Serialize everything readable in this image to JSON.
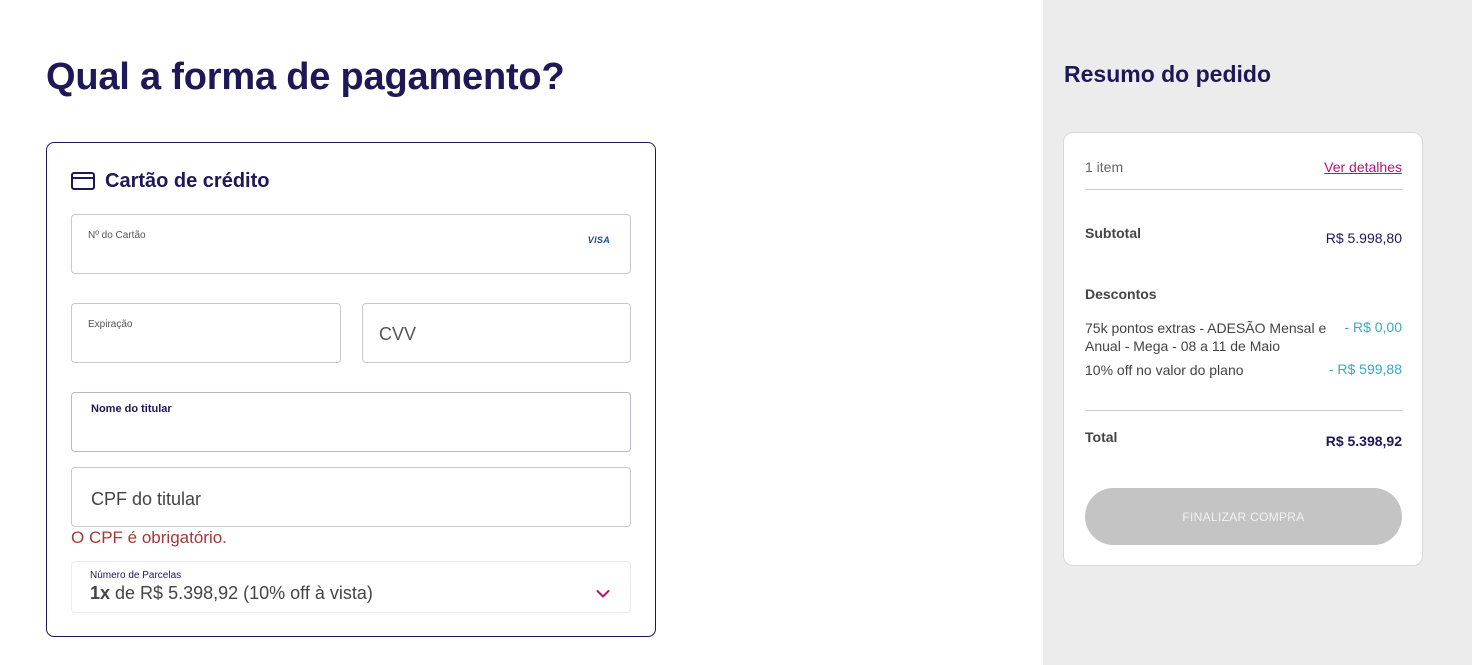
{
  "payment": {
    "title": "Qual a forma de pagamento?",
    "method_title": "Cartão de crédito",
    "method_icon": "credit-card-icon",
    "card_number_label": "Nº do Cartão",
    "card_brand": "VISA",
    "expiration_label": "Expiração",
    "cvv_placeholder": "CVV",
    "holder_name_label": "Nome do titular",
    "cpf_placeholder": "CPF do titular",
    "cpf_error": "O CPF é obrigatório.",
    "installments_label": "Número de Parcelas",
    "installments_count": "1x",
    "installments_rest": " de R$ 5.398,92 (10% off à vista)"
  },
  "summary": {
    "title": "Resumo do pedido",
    "items_count": "1 item",
    "details_link": "Ver detalhes",
    "subtotal_label": "Subtotal",
    "subtotal_value": "R$ 5.998,80",
    "discounts_label": "Descontos",
    "discounts": [
      {
        "label": "75k pontos extras - ADESÃO Mensal e Anual - Mega - 08 a 11 de Maio",
        "value": "- R$ 0,00"
      },
      {
        "label": "10% off no valor do plano",
        "value": "- R$ 599,88"
      }
    ],
    "total_label": "Total",
    "total_value": "R$ 5.398,92",
    "finalize_label": "FINALIZAR COMPRA"
  },
  "colors": {
    "brand_dark": "#1f1856",
    "link_magenta": "#b3157a",
    "discount_blue": "#3aa8c4",
    "error_red": "#a13a3a",
    "button_disabled": "#c4c4c4",
    "sidebar_bg": "#ececec"
  }
}
